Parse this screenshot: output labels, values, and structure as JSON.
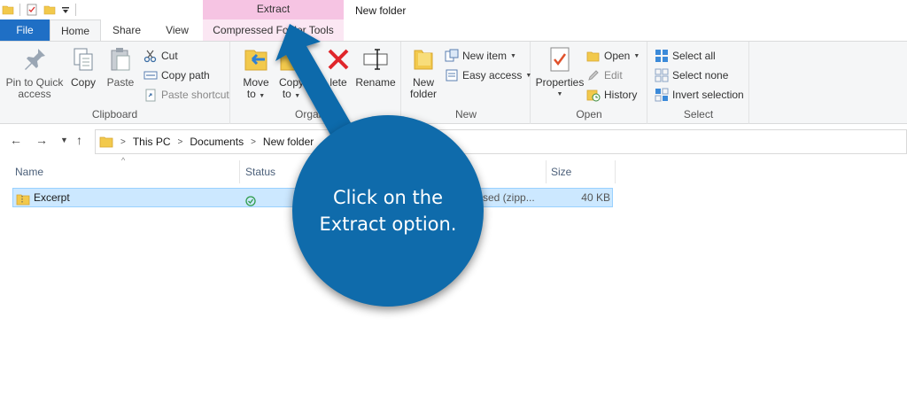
{
  "titlebar": {
    "context_tab_header": "Extract",
    "window_title": "New folder"
  },
  "tabs": {
    "file": "File",
    "home": "Home",
    "share": "Share",
    "view": "View",
    "compressed": "Compressed Folder Tools"
  },
  "ribbon": {
    "clipboard": {
      "label": "Clipboard",
      "pin_line1": "Pin to Quick",
      "pin_line2": "access",
      "copy": "Copy",
      "paste": "Paste",
      "cut": "Cut",
      "copy_path": "Copy path",
      "paste_shortcut": "Paste shortcut"
    },
    "organize": {
      "label": "Organ",
      "move_line1": "Move",
      "move_line2": "to",
      "copy_line1": "Copy",
      "copy_line2": "to",
      "delete": "lete",
      "rename": "Rename"
    },
    "new": {
      "label": "New",
      "new_folder_line1": "New",
      "new_folder_line2": "folder",
      "new_item": "New item",
      "easy_access": "Easy access"
    },
    "open": {
      "label": "Open",
      "properties": "Properties",
      "open": "Open",
      "edit": "Edit",
      "history": "History"
    },
    "select": {
      "label": "Select",
      "select_all": "Select all",
      "select_none": "Select none",
      "invert_selection": "Invert selection"
    }
  },
  "address": {
    "crumbs": [
      "This PC",
      "Documents",
      "New folder"
    ]
  },
  "columns": {
    "name": "Name",
    "status": "Status",
    "size": "Size"
  },
  "files": [
    {
      "name": "Excerpt",
      "type_partial": "ssed (zipp...",
      "size": "40 KB"
    }
  ],
  "callout": {
    "line1": "Click on the",
    "line2": "Extract option."
  },
  "colors": {
    "accent": "#1f6fc5",
    "context_tab": "#f6c4e3",
    "callout": "#0f6bab",
    "selection": "#cce8ff"
  }
}
